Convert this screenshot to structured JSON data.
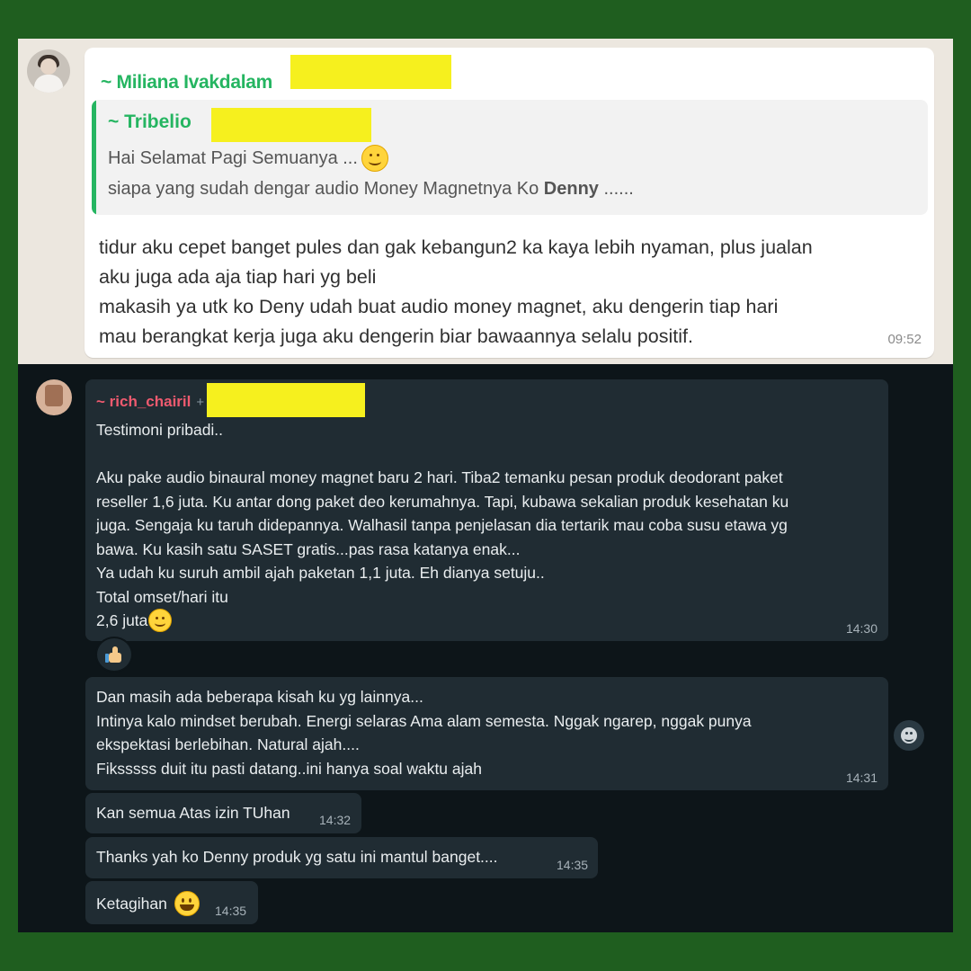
{
  "colors": {
    "frame": "#1f5e1f",
    "light_sender": "#25b561",
    "dark_sender": "#ef5a6f",
    "redaction": "#f6f01e",
    "dark_bubble": "#202c33"
  },
  "top_chat": {
    "sender": "~ Miliana Ivakdalam",
    "quote": {
      "sender": "~ Tribelio",
      "line1": "Hai Selamat Pagi Semuanya ...",
      "line1_emoji": "smiling-face-emoji",
      "line2_prefix": "siapa yang sudah dengar audio Money Magnetnya Ko ",
      "line2_bold": "Denny",
      "line2_suffix": " ......"
    },
    "message_lines": [
      "tidur aku cepet banget pules dan gak kebangun2 ka kaya lebih nyaman, plus jualan",
      "aku juga ada aja tiap hari yg beli",
      "makasih ya  utk ko Deny udah buat audio money magnet, aku dengerin tiap hari",
      "mau berangkat kerja juga aku dengerin biar bawaannya selalu positif."
    ],
    "time": "09:52"
  },
  "bottom_chat": {
    "sender": "~ rich_chairil",
    "sender_suffix": "+",
    "message1_lines": [
      "Testimoni pribadi..",
      "",
      "Aku pake audio binaural money magnet baru 2 hari. Tiba2 temanku pesan produk deodorant paket",
      "reseller 1,6 juta. Ku antar dong paket deo kerumahnya. Tapi, kubawa sekalian produk kesehatan ku",
      "juga. Sengaja ku taruh didepannya. Walhasil tanpa penjelasan dia tertarik mau coba susu etawa yg",
      "bawa. Ku kasih satu SASET gratis...pas rasa katanya enak...",
      "Ya udah ku suruh ambil ajah paketan 1,1 juta. Eh dianya setuju..",
      "Total omset/hari itu"
    ],
    "message1_last": "2,6 juta",
    "message1_time": "14:30",
    "reaction": "thumbs-up-emoji",
    "message2_lines": [
      "Dan masih ada beberapa kisah ku yg lainnya...",
      "Intinya kalo mindset berubah. Energi selaras Ama alam semesta. Nggak ngarep, nggak punya",
      "ekspektasi berlebihan. Natural ajah....",
      "Fiksssss duit itu pasti datang..ini hanya soal waktu ajah"
    ],
    "message2_time": "14:31",
    "message3": "Kan semua Atas izin TUhan",
    "message3_time": "14:32",
    "message4": "Thanks yah ko Denny produk yg satu ini mantul banget....",
    "message4_time": "14:35",
    "message5": "Ketagihan",
    "message5_time": "14:35"
  }
}
